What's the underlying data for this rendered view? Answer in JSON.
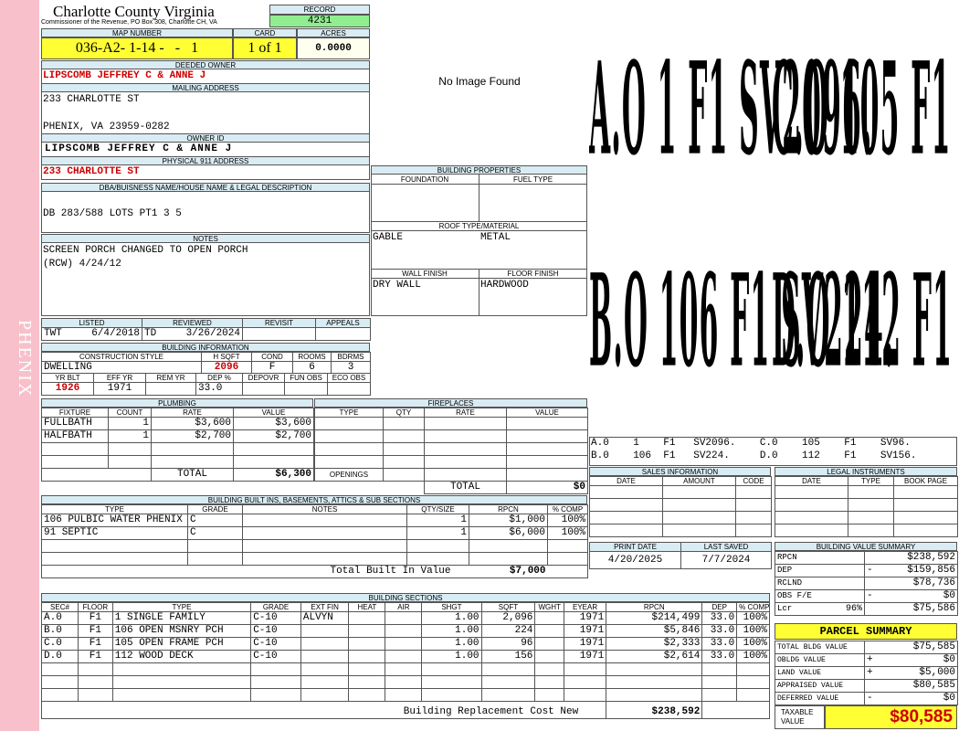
{
  "sidebar": {
    "label": "PHENIX",
    "color": "#f8c0ca"
  },
  "header": {
    "county": "Charlotte County Virginia",
    "subtitle": "Commissioner of the Revenue, PO Box 308, Charlotte CH, VA",
    "record_label": "RECORD",
    "record_value": "4231",
    "map_label": "MAP NUMBER",
    "map_value": "036-A2- 1-14 -   -   1",
    "card_label": "CARD",
    "card_value": "1 of 1",
    "acres_label": "ACRES",
    "acres_value": "0.0000"
  },
  "owner": {
    "deeded_label": "DEEDED OWNER",
    "deeded_value": "LIPSCOMB JEFFREY C & ANNE J",
    "mailing_label": "MAILING ADDRESS",
    "mailing_line1": "233 CHARLOTTE ST",
    "mailing_line2": "PHENIX, VA 23959-0282",
    "ownerid_label": "OWNER ID",
    "ownerid_value": "LIPSCOMB JEFFREY C & ANNE J",
    "physical_label": "PHYSICAL 911 ADDRESS",
    "physical_value": "233 CHARLOTTE ST"
  },
  "legal": {
    "label": "DBA/BUISNESS NAME/HOUSE NAME & LEGAL DESCRIPTION",
    "value": "DB 283/588 LOTS PT1 3 5"
  },
  "notes": {
    "label": "NOTES",
    "line1": "SCREEN PORCH CHANGED TO OPEN PORCH",
    "line2": "(RCW) 4/24/12"
  },
  "image": {
    "text": "No Image Found"
  },
  "building_properties": {
    "title": "BUILDING PROPERTIES",
    "foundation_label": "FOUNDATION",
    "fueltype_label": "FUEL TYPE",
    "roof_label": "ROOF TYPE/MATERIAL",
    "roof_type": "GABLE",
    "roof_material": "METAL",
    "wall_label": "WALL FINISH",
    "wall_value": "DRY WALL",
    "floor_label": "FLOOR FINISH",
    "floor_value": "HARDWOOD"
  },
  "listing": {
    "listed_label": "LISTED",
    "reviewed_label": "REVIEWED",
    "revisit_label": "REVISIT",
    "appeals_label": "APPEALS",
    "listed_by": "TWT",
    "listed_date": "6/4/2018",
    "reviewed_by": "TD",
    "reviewed_date": "3/26/2024"
  },
  "building_info": {
    "title": "BUILDING INFORMATION",
    "construction_label": "CONSTRUCTION STYLE",
    "hsqft_label": "H SQFT",
    "cond_label": "COND",
    "rooms_label": "ROOMS",
    "bdrms_label": "BDRMS",
    "construction_value": "DWELLING",
    "hsqft_value": "2096",
    "cond_value": "F",
    "rooms_value": "6",
    "bdrms_value": "3",
    "yrblt_label": "YR BLT",
    "effyr_label": "EFF YR",
    "remyr_label": "REM YR",
    "dep_label": "DEP %",
    "depovr_label": "DEPOVR",
    "funobs_label": "FUN OBS",
    "ecoobs_label": "ECO OBS",
    "yrblt_value": "1926",
    "effyr_value": "1971",
    "dep_value": "33.0"
  },
  "plumbing": {
    "title": "PLUMBING",
    "headers": [
      "FIXTURE",
      "COUNT",
      "RATE",
      "VALUE"
    ],
    "rows": [
      [
        "FULLBATH",
        "1",
        "$3,600",
        "$3,600"
      ],
      [
        "HALFBATH",
        "1",
        "$2,700",
        "$2,700"
      ]
    ],
    "total_label": "TOTAL",
    "total_value": "$6,300"
  },
  "fireplaces": {
    "title": "FIREPLACES",
    "headers": [
      "TYPE",
      "QTY",
      "RATE",
      "VALUE"
    ],
    "openings_label": "OPENINGS",
    "total_label": "TOTAL",
    "total_value": "$0"
  },
  "built_ins": {
    "title": "BUILDING BUILT INS, BASEMENTS, ATTICS & SUB SECTIONS",
    "headers": [
      "TYPE",
      "GRADE",
      "NOTES",
      "QTY/SIZE",
      "RPCN",
      "% COMP"
    ],
    "rows": [
      [
        "106 PULBIC WATER PHENIX",
        "C",
        "",
        "1",
        "$1,000",
        "100%"
      ],
      [
        "91 SEPTIC",
        "C",
        "",
        "1",
        "$6,000",
        "100%"
      ]
    ],
    "total_label": "Total Built In Value",
    "total_value": "$7,000"
  },
  "sketch": {
    "labels": [
      "A.O  1   F1  SV2096.",
      "C.O  105  F1  SV96.",
      "B.O  106  F1  SV224.",
      "D.O  112  F1  SV156."
    ],
    "legend_row1": "A.0    1    F1   SV2096.    C.0    105    F1    SV96.",
    "legend_row2": "B.0    106  F1   SV224.     D.0    112    F1    SV156."
  },
  "sales": {
    "title": "SALES INFORMATION",
    "headers": [
      "DATE",
      "AMOUNT",
      "CODE"
    ]
  },
  "legal_instruments": {
    "title": "LEGAL INSTRUMENTS",
    "headers": [
      "DATE",
      "TYPE",
      "BOOK PAGE"
    ]
  },
  "dates": {
    "print_label": "PRINT DATE",
    "print_value": "4/20/2025",
    "saved_label": "LAST SAVED",
    "saved_value": "7/7/2024"
  },
  "value_summary": {
    "title": "BUILDING VALUE SUMMARY",
    "rows": [
      {
        "label": "RPCN",
        "sign": "",
        "pct": "",
        "value": "$238,592"
      },
      {
        "label": "DEP",
        "sign": "-",
        "pct": "",
        "value": "$159,856"
      },
      {
        "label": "RCLND",
        "sign": "",
        "pct": "",
        "value": "$78,736"
      },
      {
        "label": "OBS F/E",
        "sign": "-",
        "pct": "",
        "value": "$0"
      },
      {
        "label": "Lcr",
        "sign": "",
        "pct": "96%",
        "value": "$75,586"
      }
    ]
  },
  "building_sections": {
    "title": "BUILDING SECTIONS",
    "headers": [
      "SEC#",
      "FLOOR",
      "TYPE",
      "GRADE",
      "EXT FIN",
      "HEAT",
      "AIR",
      "SHGT",
      "SQFT",
      "WGHT",
      "EYEAR",
      "RPCN",
      "DEP",
      "% COMP"
    ],
    "rows": [
      [
        "A.0",
        "F1",
        "1 SINGLE FAMILY",
        "C-10",
        "ALVYN",
        "",
        "",
        "1.00",
        "2,096",
        "",
        "1971",
        "$214,499",
        "33.0",
        "100%"
      ],
      [
        "B.0",
        "F1",
        "106 OPEN MSNRY PCH",
        "C-10",
        "",
        "",
        "",
        "1.00",
        "224",
        "",
        "1971",
        "$5,846",
        "33.0",
        "100%"
      ],
      [
        "C.0",
        "F1",
        "105 OPEN FRAME PCH",
        "C-10",
        "",
        "",
        "",
        "1.00",
        "96",
        "",
        "1971",
        "$2,333",
        "33.0",
        "100%"
      ],
      [
        "D.0",
        "F1",
        "112 WOOD DECK",
        "C-10",
        "",
        "",
        "",
        "1.00",
        "156",
        "",
        "1971",
        "$2,614",
        "33.0",
        "100%"
      ]
    ],
    "total_label": "Building Replacement Cost New",
    "total_value": "$238,592"
  },
  "parcel_summary": {
    "title": "PARCEL SUMMARY",
    "rows": [
      {
        "label": "TOTAL BLDG VALUE",
        "sign": "",
        "value": "$75,585"
      },
      {
        "label": "OBLDG VALUE",
        "sign": "+",
        "value": "$0"
      },
      {
        "label": "LAND VALUE",
        "sign": "+",
        "value": "$5,000"
      },
      {
        "label": "APPRAISED VALUE",
        "sign": "",
        "value": "$80,585"
      },
      {
        "label": "DEFERRED VALUE",
        "sign": "-",
        "value": "$0"
      }
    ],
    "taxable_label_1": "TAXABLE",
    "taxable_label_2": "VALUE",
    "taxable_value": "$80,585"
  }
}
